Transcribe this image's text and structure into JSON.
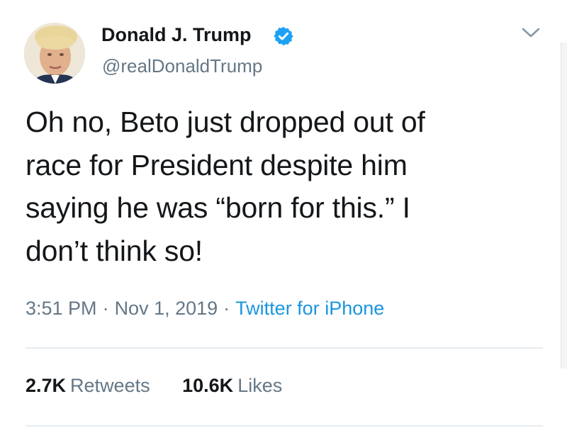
{
  "author": {
    "display_name": "Donald J. Trump",
    "handle": "@realDonaldTrump",
    "verified": true,
    "avatar_icon": "profile-photo"
  },
  "menu": {
    "icon": "chevron-down-icon"
  },
  "tweet": {
    "lines": [
      "Oh no, Beto just dropped out of",
      "race for President despite him",
      "saying he was “born for this.” I",
      "don’t think so!"
    ]
  },
  "meta": {
    "time": "3:51 PM",
    "separator": "·",
    "date": "Nov 1, 2019",
    "source": "Twitter for iPhone"
  },
  "stats": {
    "retweets_count": "2.7K",
    "retweets_label": "Retweets",
    "likes_count": "10.6K",
    "likes_label": "Likes"
  },
  "colors": {
    "text": "#14171a",
    "secondary": "#657786",
    "link": "#1b95e0",
    "verified": "#1da1f2",
    "divider": "#e6ecf0"
  }
}
